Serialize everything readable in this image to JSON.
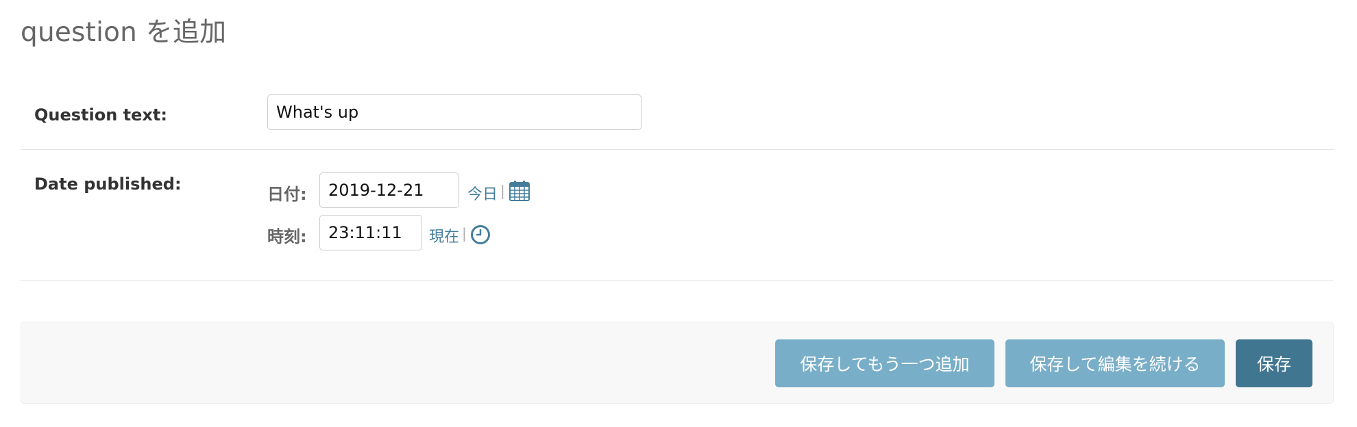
{
  "page": {
    "title": "question を追加"
  },
  "fields": {
    "question_text": {
      "label": "Question text:",
      "value": "What's up"
    },
    "date_published": {
      "label": "Date published:",
      "date_label": "日付:",
      "date_value": "2019-12-21",
      "today_link": "今日",
      "time_label": "時刻:",
      "time_value": "23:11:11",
      "now_link": "現在",
      "separator": "|"
    }
  },
  "icons": {
    "calendar": "calendar-icon",
    "clock": "clock-icon"
  },
  "buttons": {
    "save_add_another": "保存してもう一つ追加",
    "save_continue": "保存して編集を続ける",
    "save": "保存"
  },
  "colors": {
    "link": "#447e9b",
    "button_secondary": "#79aec8",
    "button_primary": "#417690",
    "title": "#666666"
  }
}
